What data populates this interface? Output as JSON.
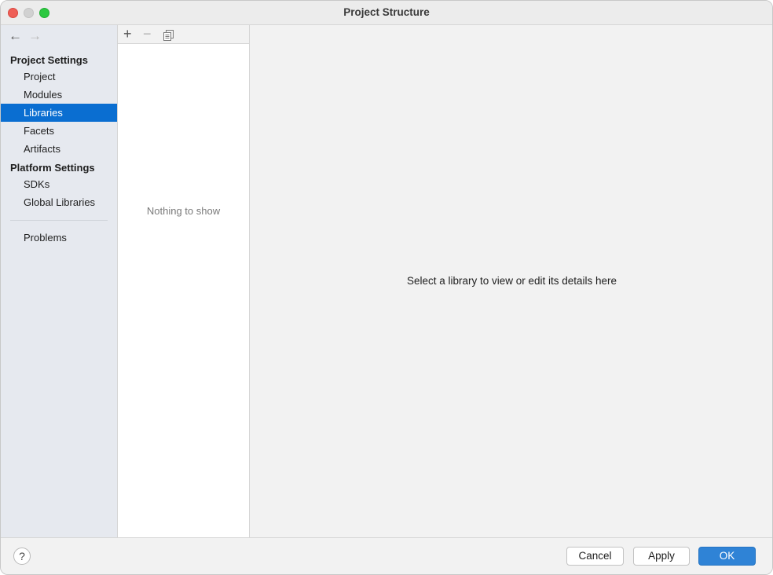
{
  "window": {
    "title": "Project Structure"
  },
  "nav": {
    "back_icon": "←",
    "forward_icon": "→"
  },
  "sidebar": {
    "project_settings_title": "Project Settings",
    "project_items": [
      {
        "label": "Project"
      },
      {
        "label": "Modules"
      },
      {
        "label": "Libraries",
        "selected": true
      },
      {
        "label": "Facets"
      },
      {
        "label": "Artifacts"
      }
    ],
    "platform_settings_title": "Platform Settings",
    "platform_items": [
      {
        "label": "SDKs"
      },
      {
        "label": "Global Libraries"
      }
    ],
    "problems_label": "Problems"
  },
  "list": {
    "toolbar": {
      "add_icon": "+",
      "remove_icon": "−",
      "copy_icon": "⧉"
    },
    "empty_text": "Nothing to show"
  },
  "detail": {
    "placeholder": "Select a library to view or edit its details here"
  },
  "footer": {
    "help_label": "?",
    "cancel_label": "Cancel",
    "apply_label": "Apply",
    "ok_label": "OK"
  },
  "colors": {
    "selected_bg": "#0a6ed1",
    "ok_button": "#2f83d6",
    "sidebar_bg": "#e6e9ef"
  }
}
